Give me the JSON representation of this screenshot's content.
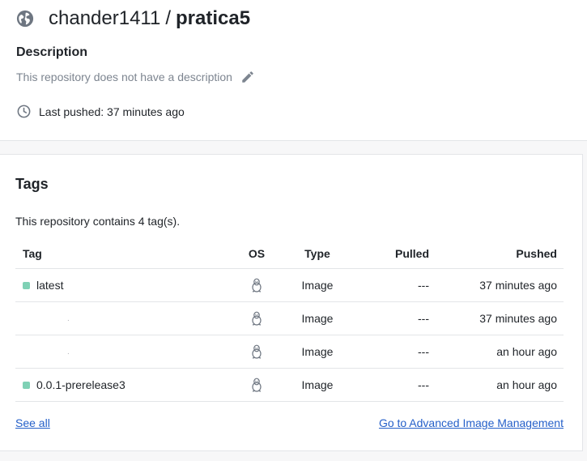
{
  "repo": {
    "owner": "chander1411",
    "separator": "/",
    "name": "pratica5"
  },
  "description": {
    "label": "Description",
    "text": "This repository does not have a description"
  },
  "last_pushed": "Last pushed: 37 minutes ago",
  "tags": {
    "title": "Tags",
    "count_text": "This repository contains 4 tag(s).",
    "columns": {
      "tag": "Tag",
      "os": "OS",
      "type": "Type",
      "pulled": "Pulled",
      "pushed": "Pushed"
    },
    "rows": [
      {
        "tag": "latest",
        "os": "linux-icon",
        "type": "Image",
        "pulled": "---",
        "pushed": "37 minutes ago"
      },
      {
        "tag": ".",
        "os": "linux-icon",
        "type": "Image",
        "pulled": "---",
        "pushed": "37 minutes ago"
      },
      {
        "tag": ".",
        "os": "linux-icon",
        "type": "Image",
        "pulled": "---",
        "pushed": "an hour ago"
      },
      {
        "tag": "0.0.1-prerelease3",
        "os": "linux-icon",
        "type": "Image",
        "pulled": "---",
        "pushed": "an hour ago"
      }
    ],
    "see_all": "See all",
    "advanced_link": "Go to Advanced Image Management"
  },
  "colors": {
    "link": "#2560c9",
    "tag_dot": "#7fd1b5",
    "muted_text": "#7d8590"
  }
}
